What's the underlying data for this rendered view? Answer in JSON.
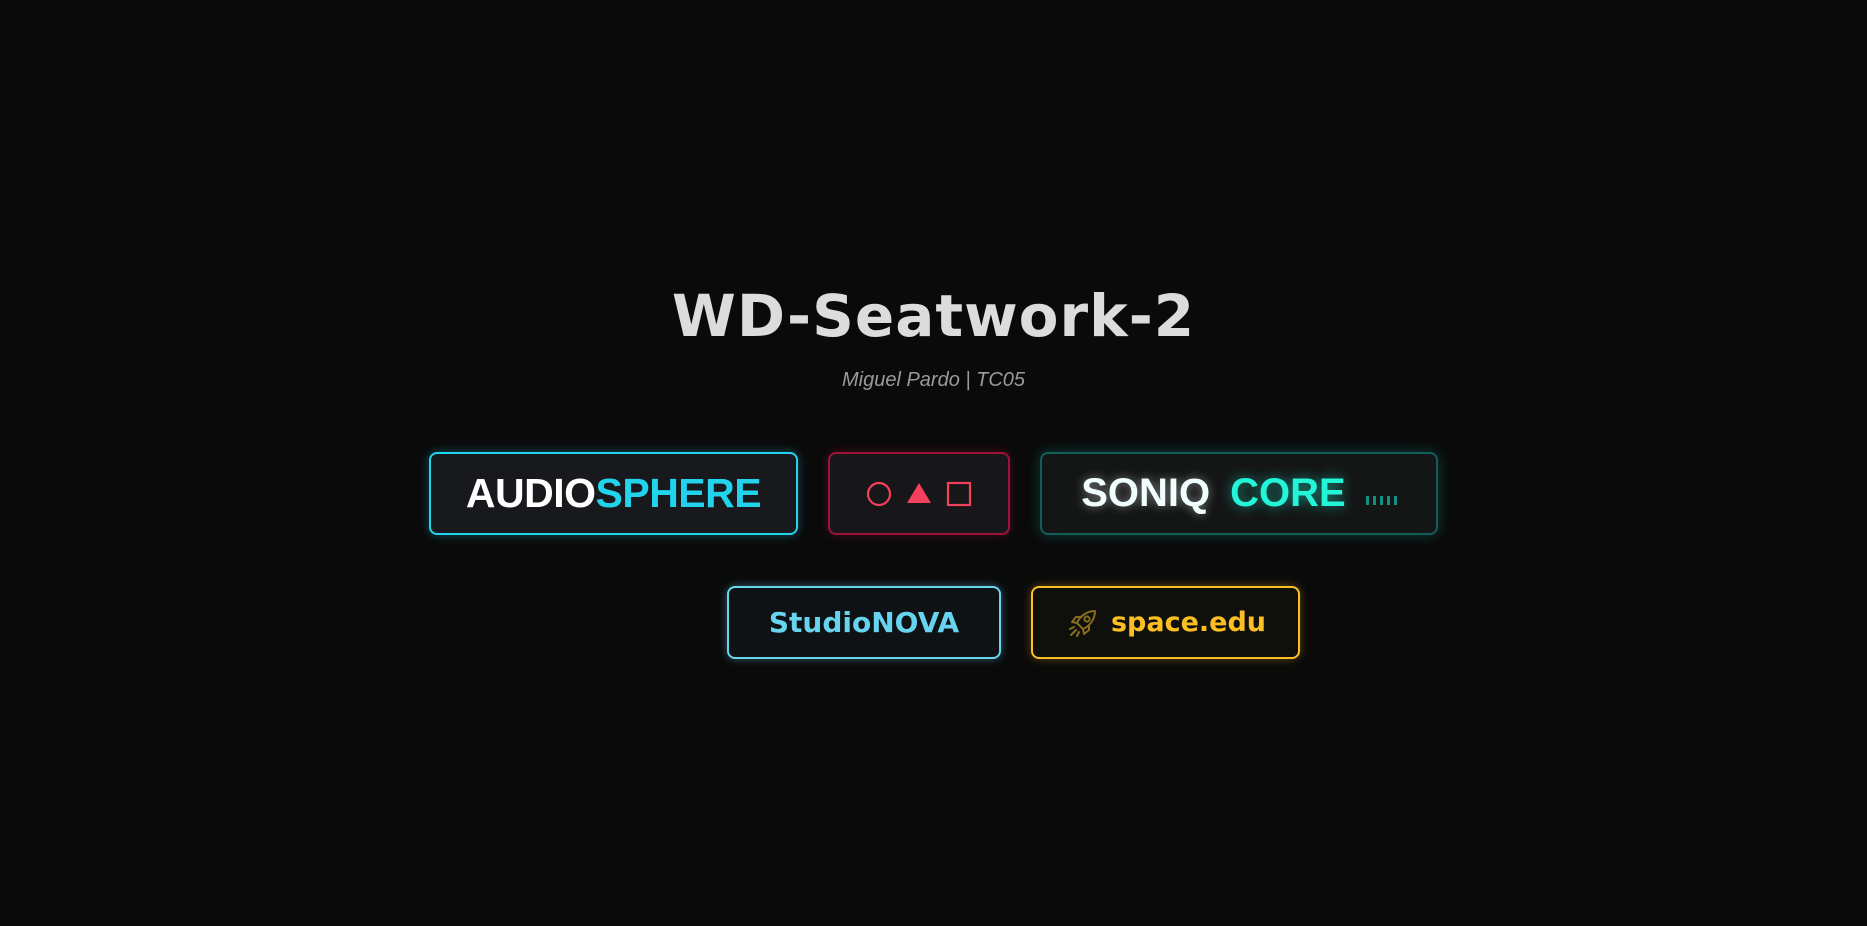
{
  "header": {
    "title": "WD-Seatwork-2",
    "subtitle": "Miguel Pardo | TC05"
  },
  "logos": {
    "audiosphere": {
      "part1": "AUDIO",
      "part2": "SPHERE",
      "accent": "#22d3ee"
    },
    "shapes": {
      "icons": [
        "circle-icon",
        "triangle-icon",
        "square-icon"
      ],
      "accent": "#f43f5e"
    },
    "soniq_core": {
      "part1": "SONIQ",
      "part2": "CORE",
      "accent": "#22f5d8",
      "icon": "equalizer-bars-icon"
    },
    "studionova": {
      "label": "StudioNOVA",
      "accent": "#67d4ef"
    },
    "spaceedu": {
      "label": "space.edu",
      "accent": "#fbbf24",
      "icon": "rocket-icon"
    }
  }
}
